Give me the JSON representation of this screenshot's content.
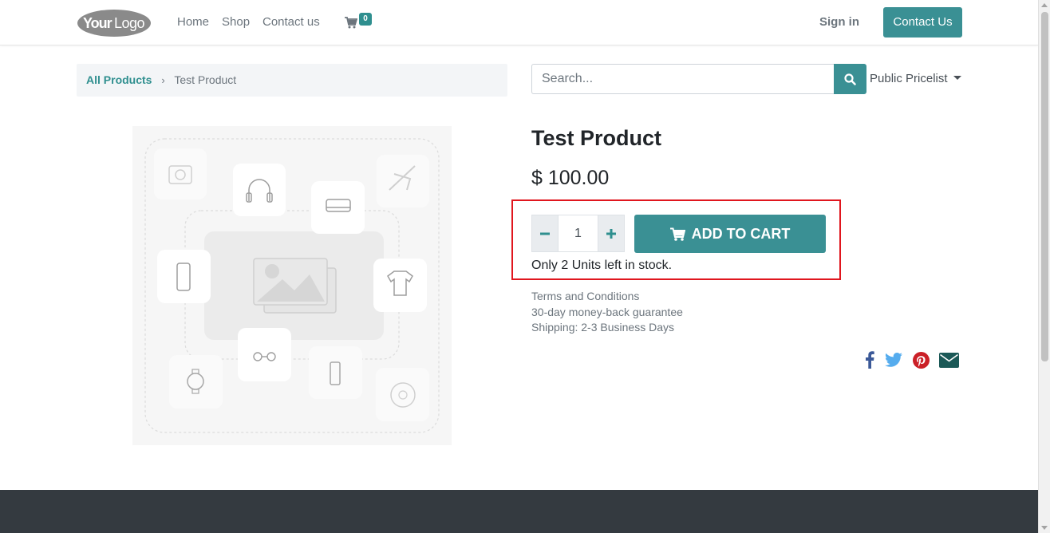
{
  "header": {
    "logo_text": "YourLogo",
    "nav": [
      {
        "label": "Home"
      },
      {
        "label": "Shop"
      },
      {
        "label": "Contact us"
      }
    ],
    "cart_count": "0",
    "signin_label": "Sign in",
    "contact_button": "Contact Us"
  },
  "breadcrumb": {
    "parent": "All Products",
    "current": "Test Product"
  },
  "search": {
    "placeholder": "Search...",
    "pricelist_label": "Public Pricelist"
  },
  "product": {
    "name": "Test Product",
    "price": "$ 100.00",
    "quantity": "1",
    "add_to_cart_label": "ADD TO CART",
    "stock_message": "Only 2 Units left in stock.",
    "terms": [
      "Terms and Conditions",
      "30-day money-back guarantee",
      "Shipping: 2-3 Business Days"
    ]
  },
  "share": [
    {
      "icon": "facebook-icon",
      "color": "#3b5998"
    },
    {
      "icon": "twitter-icon",
      "color": "#55acee"
    },
    {
      "icon": "pinterest-icon",
      "color": "#cb2027"
    },
    {
      "icon": "envelope-icon",
      "color": "#1b5957"
    }
  ],
  "colors": {
    "accent": "#3a9094",
    "highlight_border": "#e0161e",
    "footer": "#343a40"
  }
}
